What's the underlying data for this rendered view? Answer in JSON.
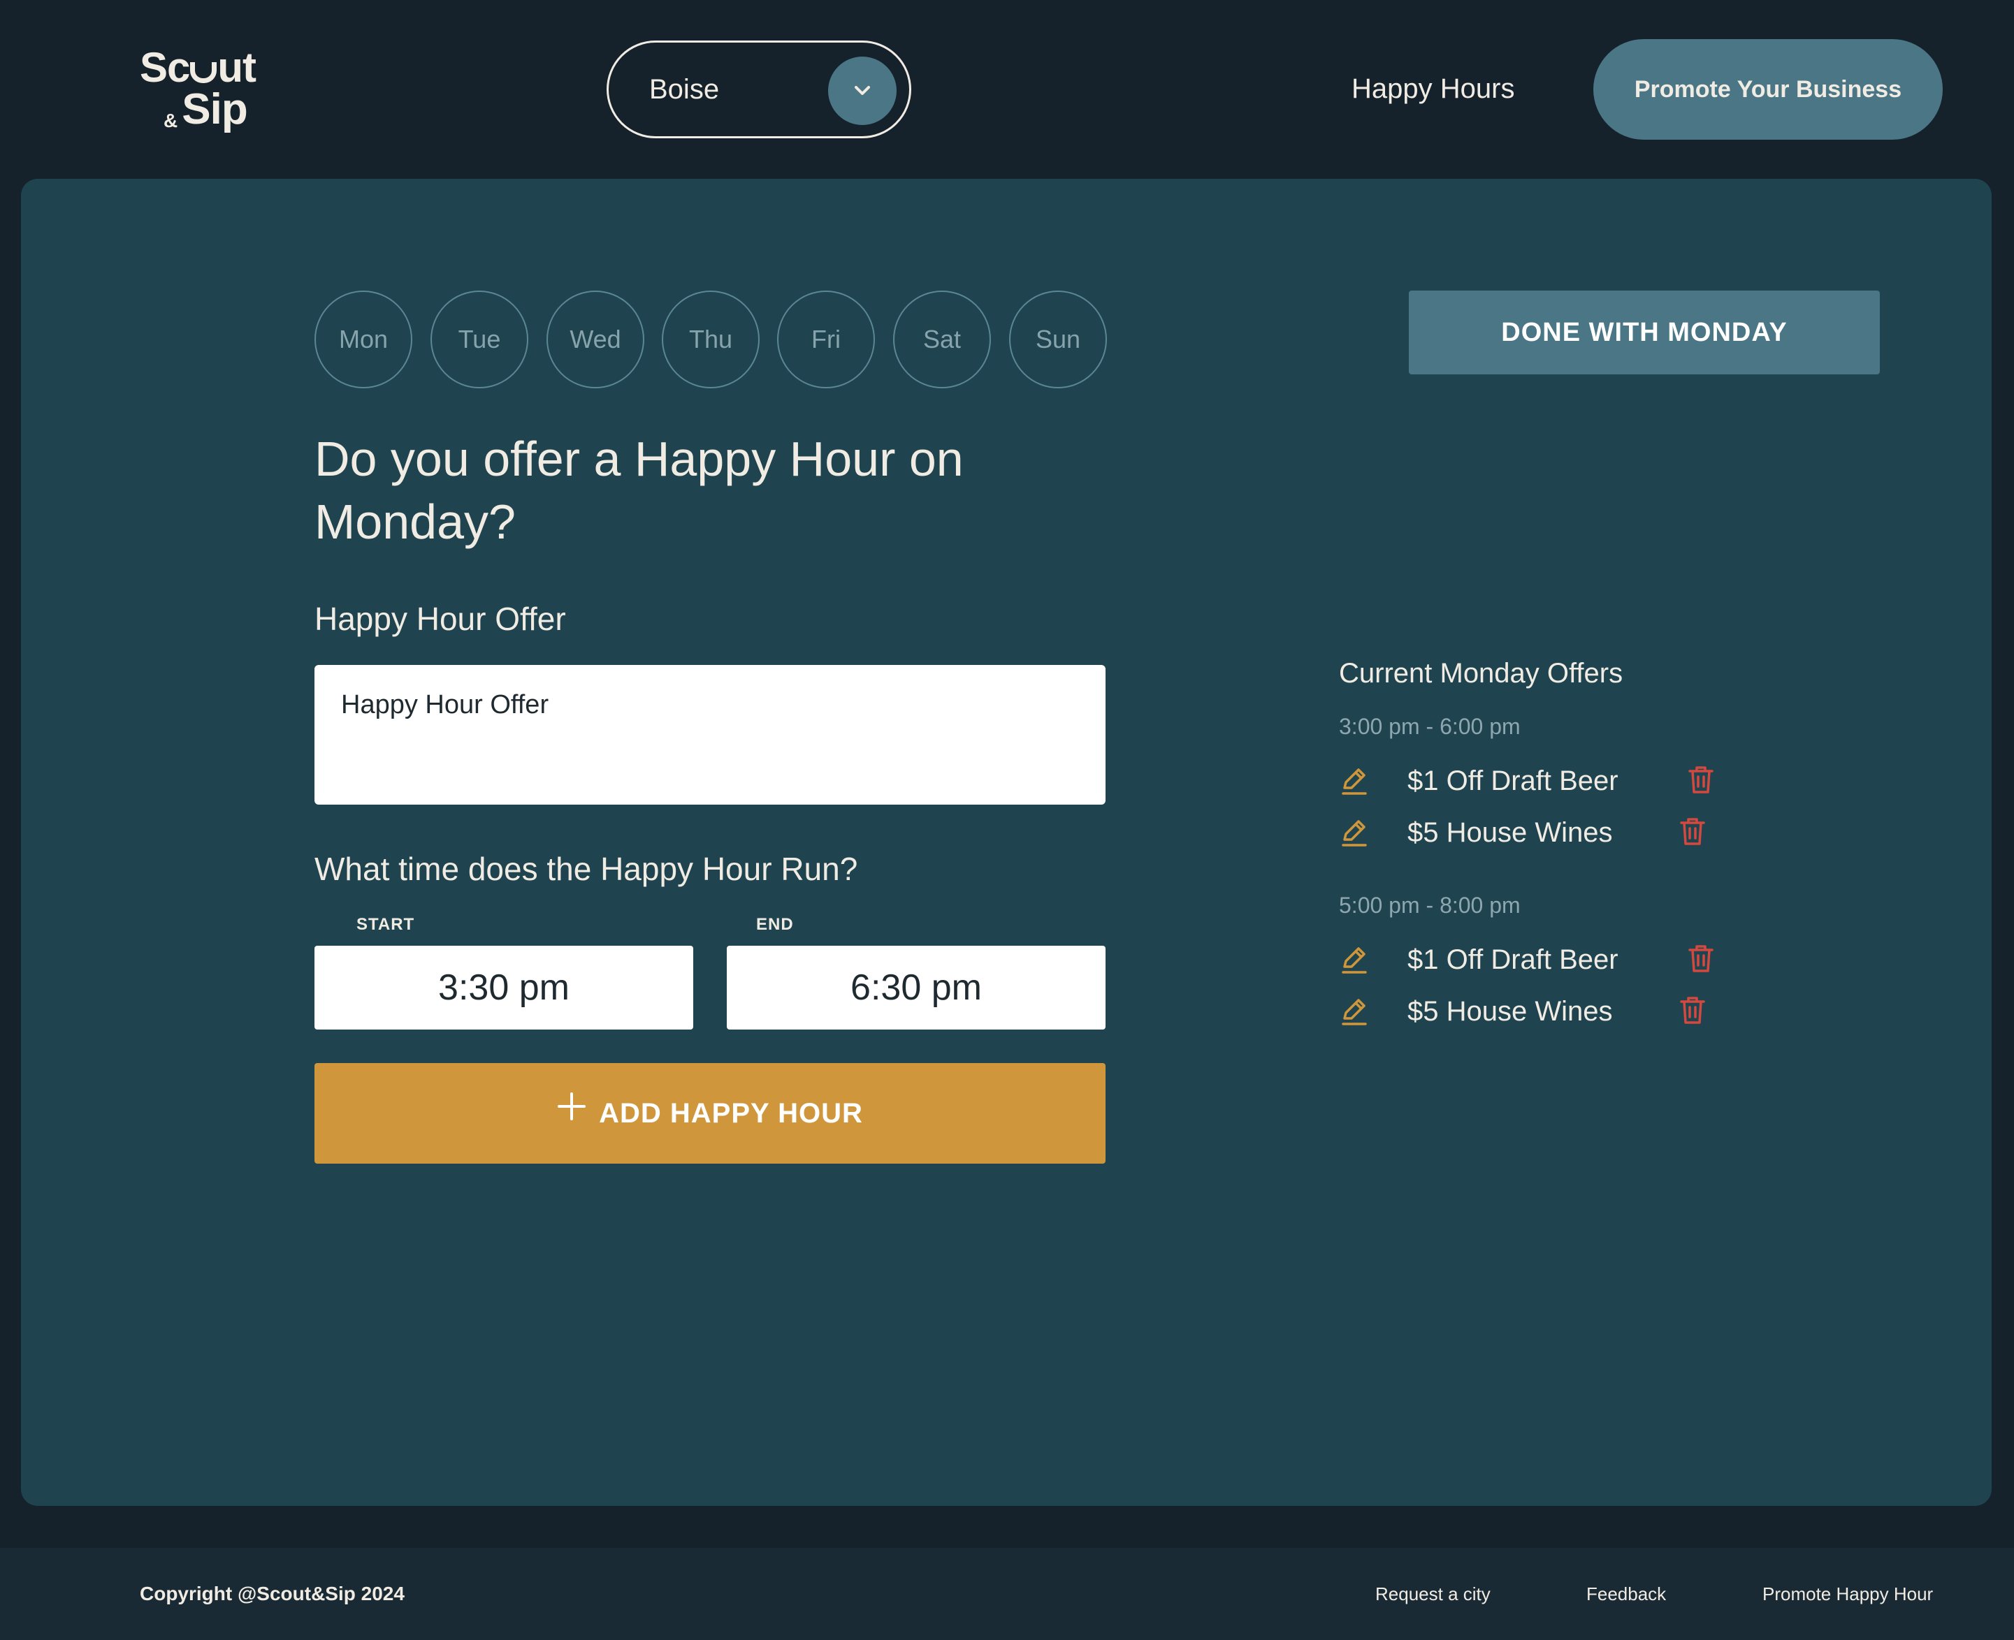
{
  "brand": {
    "logo_line1_a": "Sc",
    "logo_line1_b": "ut",
    "logo_amp": "&",
    "logo_line2": "Sip"
  },
  "header": {
    "city": "Boise",
    "nav_happy_hours": "Happy Hours",
    "promote_button": "Promote Your Business",
    "accent_color": "#4a7685"
  },
  "days": [
    "Mon",
    "Tue",
    "Wed",
    "Thu",
    "Fri",
    "Sat",
    "Sun"
  ],
  "form": {
    "question": "Do you offer a Happy Hour on Monday?",
    "offer_label": "Happy Hour Offer",
    "offer_placeholder": "Happy Hour Offer",
    "time_label": "What time does the Happy Hour Run?",
    "start_caption": "START",
    "end_caption": "END",
    "start_value": "3:30 pm",
    "end_value": "6:30 pm",
    "add_button": "ADD HAPPY HOUR",
    "add_button_color": "#d0963c",
    "done_button": "DONE WITH MONDAY"
  },
  "offers": {
    "title": "Current Monday Offers",
    "slots": [
      {
        "time": "3:00 pm - 6:00 pm",
        "items": [
          "$1 Off Draft Beer",
          "$5 House Wines"
        ]
      },
      {
        "time": "5:00 pm - 8:00 pm",
        "items": [
          "$1 Off Draft Beer",
          "$5 House Wines"
        ]
      }
    ],
    "edit_icon": "pencil-icon",
    "delete_icon": "trash-icon",
    "edit_color": "#d0963c",
    "delete_color": "#d2493f"
  },
  "footer": {
    "copyright": "Copyright @Scout&Sip 2024",
    "links": [
      "Request a city",
      "Feedback",
      "Promote Happy Hour"
    ]
  }
}
